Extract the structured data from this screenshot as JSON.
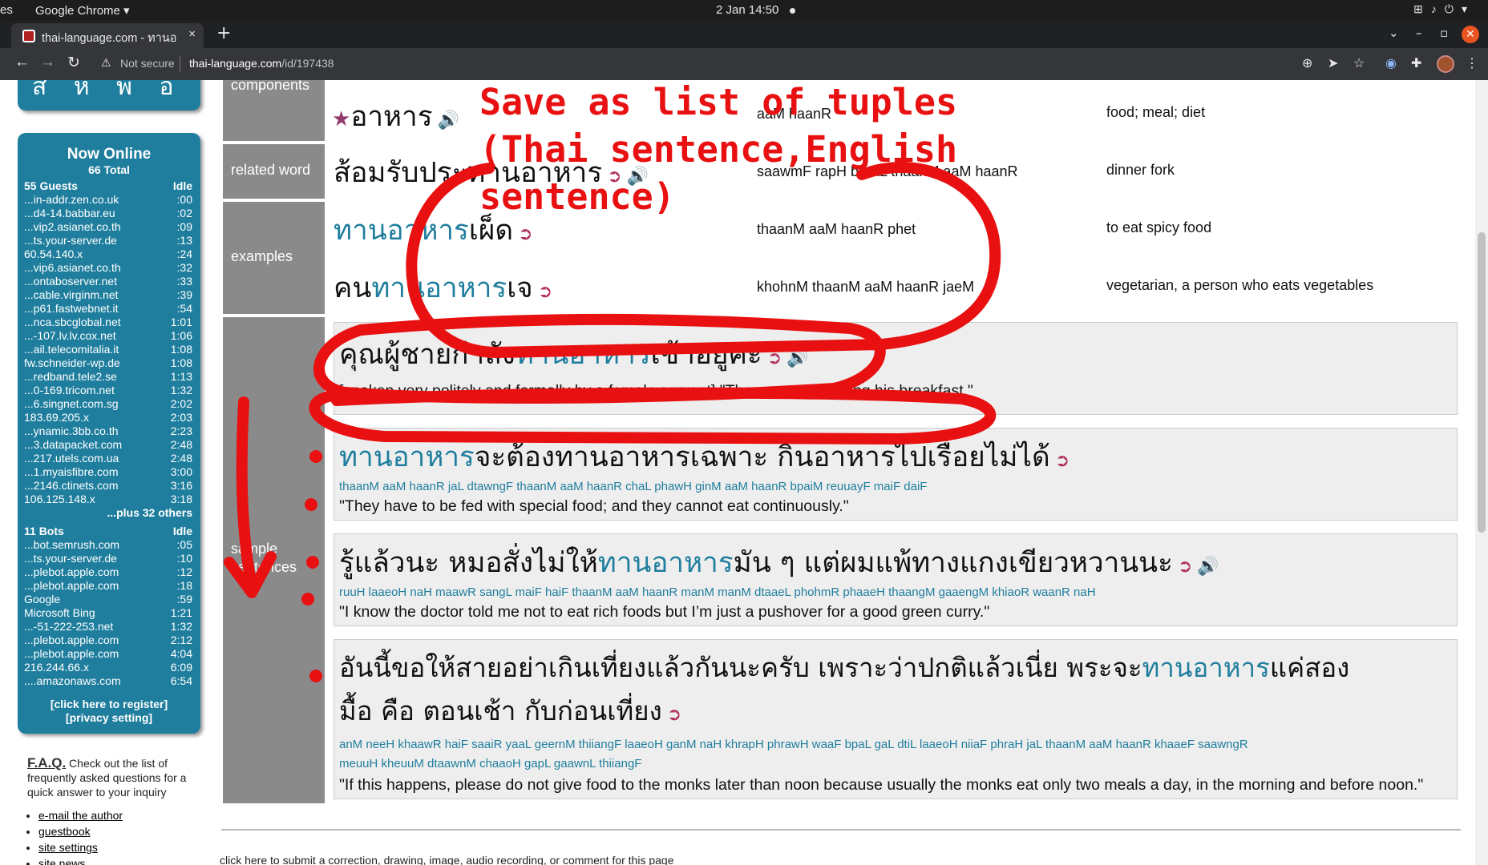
{
  "os_bar": {
    "left_text": "es",
    "app_menu": "Google Chrome ▾",
    "clock": "2 Jan  14:50"
  },
  "browser": {
    "tab_title": "thai-language.com - ทานอ",
    "tab_close": "×",
    "new_tab": "+",
    "not_secure": "Not secure",
    "url_host": "thai-language.com",
    "url_path": "/id/197438"
  },
  "sidebar": {
    "top_letters": "ส ห พ อ อ",
    "now_online_title": "Now Online",
    "total": "66 Total",
    "guests_header": "55 Guests",
    "idle_label": "Idle",
    "guests": [
      {
        "host": "...in-addr.zen.co.uk",
        "idle": ":00"
      },
      {
        "host": "...d4-14.babbar.eu",
        "idle": ":02"
      },
      {
        "host": "...vip2.asianet.co.th",
        "idle": ":09"
      },
      {
        "host": "...ts.your-server.de",
        "idle": ":13"
      },
      {
        "host": "60.54.140.x",
        "idle": ":24"
      },
      {
        "host": "...vip6.asianet.co.th",
        "idle": ":32"
      },
      {
        "host": "...ontaboserver.net",
        "idle": ":33"
      },
      {
        "host": "...cable.virginm.net",
        "idle": ":39"
      },
      {
        "host": "...p61.fastwebnet.it",
        "idle": ":54"
      },
      {
        "host": "...nca.sbcglobal.net",
        "idle": "1:01"
      },
      {
        "host": "...-107.lv.lv.cox.net",
        "idle": "1:06"
      },
      {
        "host": "...ail.telecomitalia.it",
        "idle": "1:08"
      },
      {
        "host": "fw.schneider-wp.de",
        "idle": "1:08"
      },
      {
        "host": "...redband.tele2.se",
        "idle": "1:13"
      },
      {
        "host": "...0-169.tricom.net",
        "idle": "1:32"
      },
      {
        "host": "...6.singnet.com.sg",
        "idle": "2:02"
      },
      {
        "host": "183.69.205.x",
        "idle": "2:03"
      },
      {
        "host": "...ynamic.3bb.co.th",
        "idle": "2:23"
      },
      {
        "host": "...3.datapacket.com",
        "idle": "2:48"
      },
      {
        "host": "...217.utels.com.ua",
        "idle": "2:48"
      },
      {
        "host": "...1.myaisfibre.com",
        "idle": "3:00"
      },
      {
        "host": "...2146.ctinets.com",
        "idle": "3:16"
      },
      {
        "host": "106.125.148.x",
        "idle": "3:18"
      }
    ],
    "more_guests": "...plus 32 others",
    "bots_header": "11 Bots",
    "bots": [
      {
        "host": "...bot.semrush.com",
        "idle": ":05"
      },
      {
        "host": "...ts.your-server.de",
        "idle": ":10"
      },
      {
        "host": "...plebot.apple.com",
        "idle": ":12"
      },
      {
        "host": "...plebot.apple.com",
        "idle": ":18"
      },
      {
        "host": "Google",
        "idle": ":59"
      },
      {
        "host": "Microsoft Bing",
        "idle": "1:21"
      },
      {
        "host": "...-51-222-253.net",
        "idle": "1:32"
      },
      {
        "host": "...plebot.apple.com",
        "idle": "2:12"
      },
      {
        "host": "...plebot.apple.com",
        "idle": "4:04"
      },
      {
        "host": "216.244.66.x",
        "idle": "6:09"
      },
      {
        "host": "....amazonaws.com",
        "idle": "6:54"
      }
    ],
    "register": "[click here to register]",
    "privacy": "[privacy setting]",
    "faq_title": "F.A.Q.",
    "faq_text": " Check out the list of frequently asked questions for a quick answer to your inquiry",
    "links": [
      "e-mail the author",
      "guestbook",
      "site settings",
      "site news"
    ]
  },
  "labels": {
    "components": "components",
    "related_word": "related word",
    "examples": "examples",
    "sample_sentences_1": "sample",
    "sample_sentences_2": "sentences"
  },
  "components": [
    {
      "thai": "อาหาร",
      "roman": "aaM haanR",
      "english": "food; meal; diet"
    }
  ],
  "related": [
    {
      "thai_pre": "ส้อมรับประทาน",
      "thai_hl": "อาหาร",
      "roman": "saawmF rapH bpraL thaanM aaM haanR",
      "english": "dinner fork"
    }
  ],
  "examples": [
    {
      "thai_pre": "",
      "thai_hl": "ทานอาหาร",
      "thai_post": "เผ็ด",
      "roman": "thaanM aaM haanR phet",
      "english": "to eat spicy food"
    },
    {
      "thai_pre": "คน",
      "thai_hl": "ทานอาหาร",
      "thai_post": "เจ",
      "roman": "khohnM thaanM aaM haanR jaeM",
      "english": "vegetarian, a person who eats vegetables"
    }
  ],
  "sentences": [
    {
      "thai_pre": "คุณผู้ชายกำลัง",
      "thai_hl": "ทานอาหาร",
      "thai_post": "เช้าอยู่ค่ะ",
      "translit": "",
      "english": "[spoken very politely and formally by a female servant] \"The master is having his breakfast.\""
    },
    {
      "thai_pre": "",
      "thai_hl": "ทานอาหาร",
      "thai_post": "จะต้องทานอาหารเฉพาะ กินอาหารไปเรื่อยไม่ได้",
      "translit": "thaanM aaM haanR jaL dtawngF thaanM aaM haanR chaL phawH ginM aaM haanR bpaiM reuuayF maiF daiF",
      "english": "\"They have to be fed with special food; and they cannot eat continuously.\""
    },
    {
      "thai_pre": "รู้แล้วนะ หมอสั่งไม่ให้",
      "thai_hl": "ทานอาหาร",
      "thai_post": "มัน ๆ แต่ผมแพ้ทางแกงเขียวหวานนะ",
      "translit": "ruuH laaeoH naH maawR sangL maiF haiF thaanM aaM haanR manM manM dtaaeL phohmR phaaeH thaangM gaaengM khiaoR waanR naH",
      "english": "\"I know the doctor told me not to eat rich foods but I’m just a pushover for a good green curry.\""
    },
    {
      "thai_pre": "อันนี้ขอให้สายอย่าเกินเที่ยงแล้วกันนะครับ เพราะว่าปกติแล้วเนี่ย พระจะ",
      "thai_hl": "ทานอาหาร",
      "thai_post": "แค่สอง",
      "thai_line2": "มื้อ คือ ตอนเช้า กับก่อนเที่ยง",
      "translit": "anM neeH khaawR haiF saaiR yaaL geernM thiiangF laaeoH ganM naH khrapH phrawH waaF bpaL gaL dtiL laaeoH niiaF phraH jaL thaanM aaM haanR khaaeF saawngR",
      "translit2": "meuuH kheuuM dtaawnM chaaoH gapL gaawnL thiiangF",
      "english": "\"If this happens, please do not give food to the monks later than noon because usually the monks eat only two meals a day, in the morning and before noon.\""
    }
  ],
  "submit_text": "click here to submit a correction, drawing, image, audio recording, or comment for this page",
  "annotation": {
    "line1": "Save as list of tuples",
    "line2": "(Thai sentence,English",
    "line3": "sentence)"
  }
}
